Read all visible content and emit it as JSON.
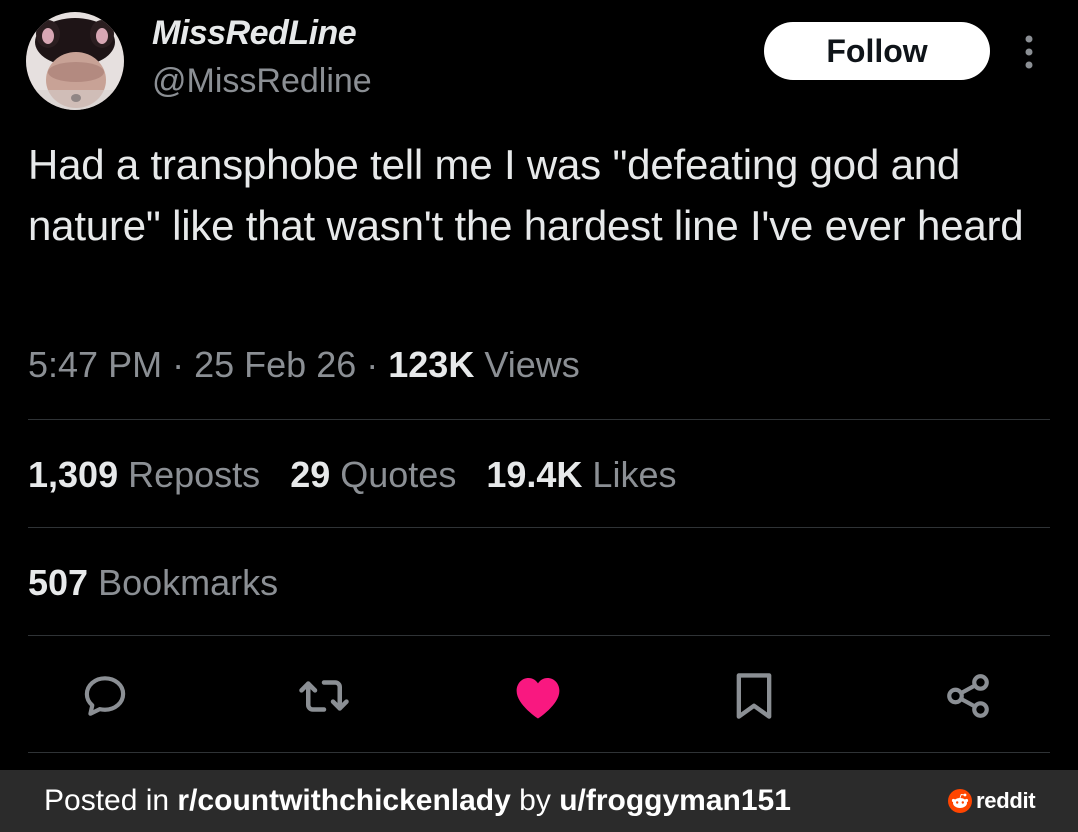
{
  "post": {
    "display_name": "MissRedLine",
    "handle": "@MissRedline",
    "follow_label": "Follow",
    "text": "Had a transphobe tell me I was \"defeating god and nature\" like that wasn't the hardest line I've ever heard",
    "time": "5:47 PM",
    "separator": "·",
    "date": "25 Feb 26",
    "views_count": "123K",
    "views_label": "Views"
  },
  "stats": {
    "reposts_count": "1,309",
    "reposts_label": "Reposts",
    "quotes_count": "29",
    "quotes_label": "Quotes",
    "likes_count": "19.4K",
    "likes_label": "Likes",
    "bookmarks_count": "507",
    "bookmarks_label": "Bookmarks"
  },
  "actions": {
    "reply_icon": "reply-icon",
    "repost_icon": "repost-icon",
    "like_icon": "heart-icon",
    "bookmark_icon": "bookmark-icon",
    "share_icon": "share-icon",
    "liked": true
  },
  "footer": {
    "posted_in": "Posted in ",
    "subreddit": "r/countwithchickenlady",
    "by": " by ",
    "user": "u/froggyman151",
    "brand": "reddit"
  },
  "colors": {
    "background": "#000000",
    "text_primary": "#e7e9ea",
    "text_secondary": "#8b8f94",
    "divider": "#2f3336",
    "like_pink": "#f91880",
    "follow_bg": "#ffffff",
    "footer_bg": "#2b2b2b",
    "reddit_orange": "#ff4500"
  }
}
